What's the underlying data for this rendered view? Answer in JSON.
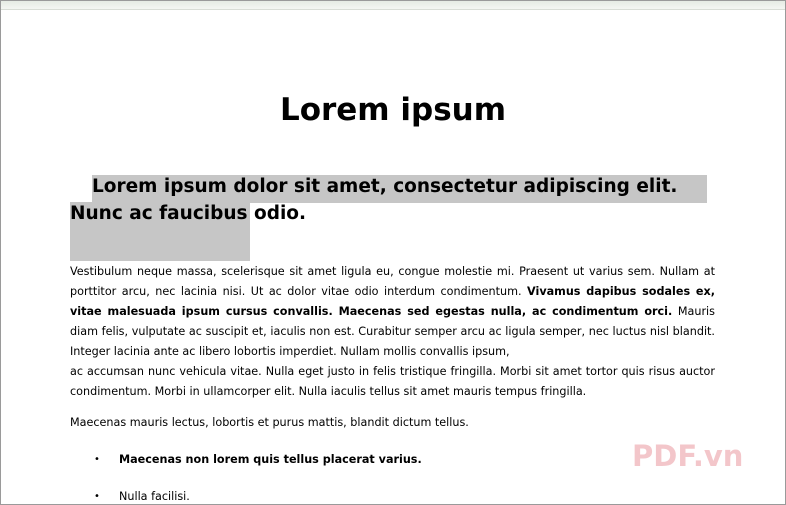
{
  "document": {
    "title": "Lorem ipsum",
    "heading": "Lorem ipsum dolor sit amet, consectetur adipiscing elit. Nunc ac faucibus odio.",
    "paragraph1": {
      "part1": "Vestibulum neque massa, scelerisque sit amet ligula eu, congue molestie mi. Praesent ut varius sem. Nullam at porttitor arcu, nec lacinia nisi. Ut ac dolor vitae odio interdum condimentum. ",
      "part2_bold": "Vivamus dapibus sodales ex, vitae malesuada ipsum cursus convallis. Maecenas sed egestas nulla, ac condimentum orci.",
      "part3": " Mauris diam felis, vulputate ac suscipit et, iaculis non est. Curabitur semper arcu ac ligula semper, nec luctus nisl blandit. Integer lacinia ante ac libero lobortis imperdiet. Nullam mollis convallis ipsum,",
      "line2": "ac accumsan nunc vehicula vitae. Nulla eget justo in felis tristique fringilla. Morbi sit amet tortor quis risus auctor condimentum. Morbi in ullamcorper elit. Nulla iaculis tellus sit amet mauris tempus fringilla."
    },
    "paragraph2": "Maecenas mauris lectus, lobortis et purus mattis, blandit dictum tellus.",
    "bullets": [
      {
        "symbol": "•",
        "text": "Maecenas non lorem quis tellus placerat varius."
      },
      {
        "symbol": "•",
        "text": "Nulla facilisi."
      }
    ]
  },
  "watermark": "PDF.vn",
  "colors": {
    "highlight": "#c6c6c6",
    "watermark": "#e27880"
  }
}
